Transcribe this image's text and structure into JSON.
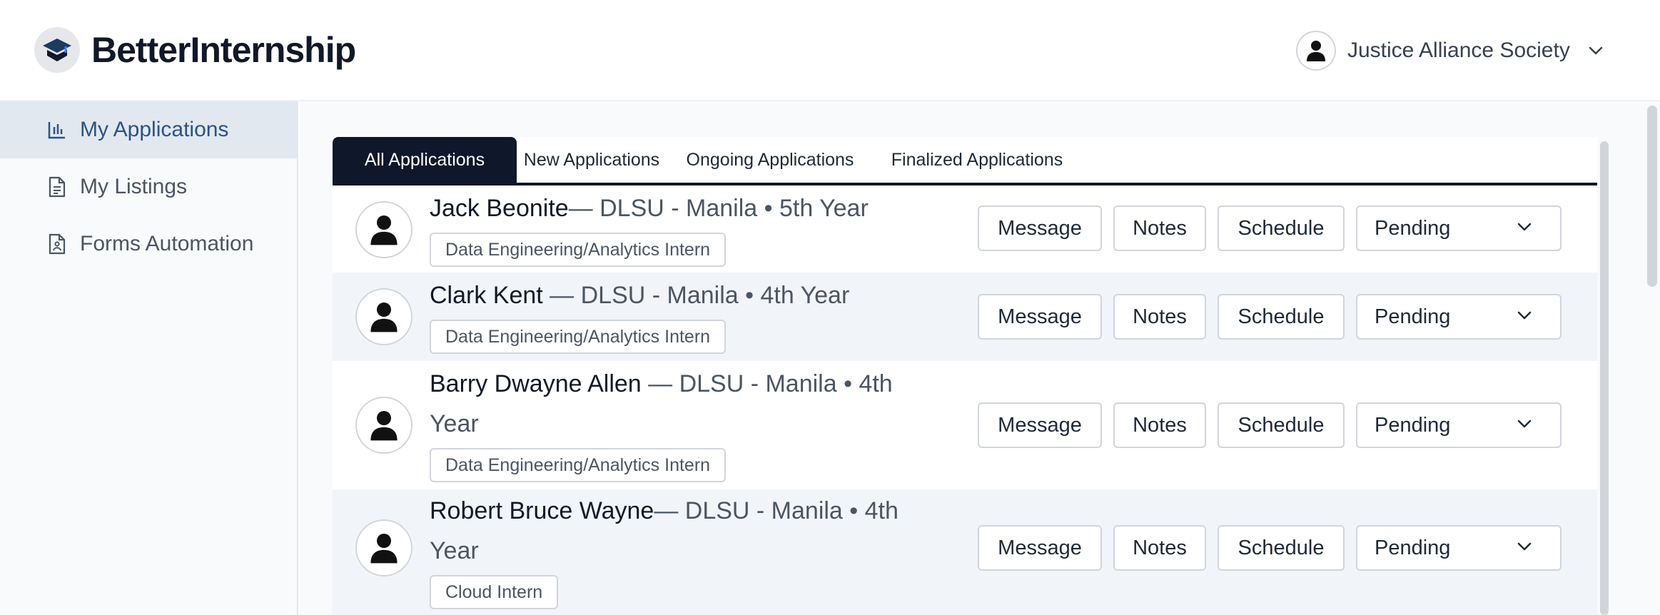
{
  "app": {
    "name": "BetterInternship",
    "account_name": "Justice Alliance Society"
  },
  "sidebar": {
    "items": [
      {
        "label": "My Applications",
        "icon": "bar-chart-icon",
        "active": true
      },
      {
        "label": "My Listings",
        "icon": "document-icon",
        "active": false
      },
      {
        "label": "Forms Automation",
        "icon": "form-document-icon",
        "active": false
      }
    ]
  },
  "tabs": [
    {
      "label": "All Applications",
      "active": true
    },
    {
      "label": "New Applications",
      "active": false
    },
    {
      "label": "Ongoing Applications",
      "active": false
    },
    {
      "label": "Finalized Applications",
      "active": false
    }
  ],
  "actions": {
    "message": "Message",
    "notes": "Notes",
    "schedule": "Schedule"
  },
  "applications": [
    {
      "name": "Jack Beonite",
      "details": "— DLSU - Manila • 5th Year",
      "position": "Data Engineering/Analytics Intern",
      "status": "Pending"
    },
    {
      "name": "Clark Kent",
      "details": " — DLSU - Manila • 4th Year",
      "position": "Data Engineering/Analytics Intern",
      "status": "Pending"
    },
    {
      "name": "Barry Dwayne Allen",
      "details": " — DLSU - Manila • 4th Year",
      "position": "Data Engineering/Analytics Intern",
      "status": "Pending"
    },
    {
      "name": "Robert Bruce Wayne",
      "details": "— DLSU - Manila • 4th Year",
      "position": "Cloud Intern",
      "status": "Pending"
    }
  ],
  "colors": {
    "brand_dark": "#0f172a",
    "accent_blue": "#2c5282",
    "active_nav_bg": "#e2e8f0",
    "alt_row_bg": "#f1f5f9"
  }
}
